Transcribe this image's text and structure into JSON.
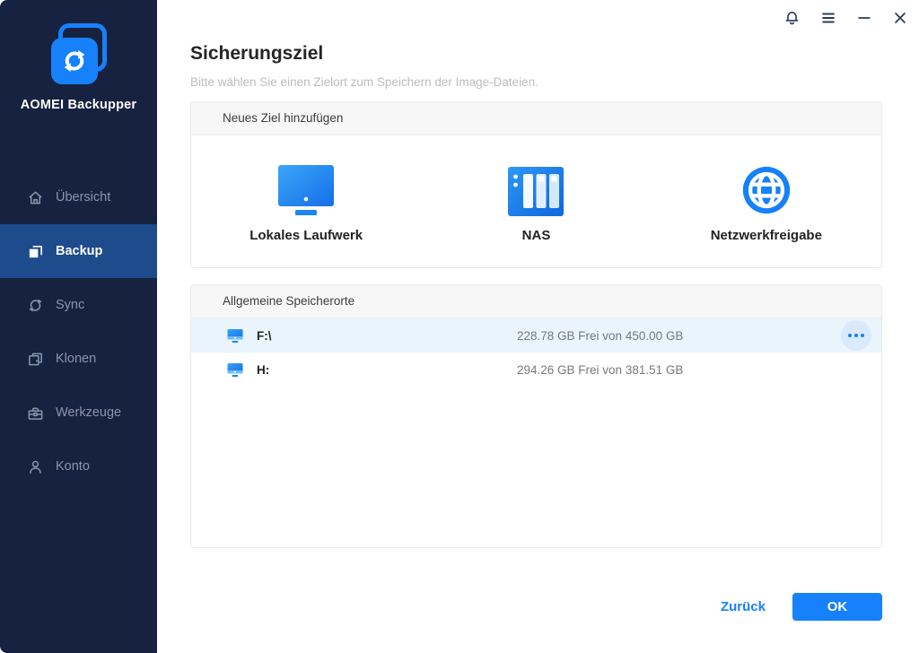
{
  "window": {
    "titlebar_icons": [
      "bell-icon",
      "menu-icon",
      "minimize-icon",
      "close-icon"
    ]
  },
  "sidebar": {
    "brand": "AOMEI Backupper",
    "logo_icon": "sync-arrows-icon",
    "items": [
      {
        "label": "Übersicht",
        "icon": "home-icon",
        "active": false
      },
      {
        "label": "Backup",
        "icon": "backup-icon",
        "active": true
      },
      {
        "label": "Sync",
        "icon": "sync-icon",
        "active": false
      },
      {
        "label": "Klonen",
        "icon": "clone-icon",
        "active": false
      },
      {
        "label": "Werkzeuge",
        "icon": "toolbox-icon",
        "active": false
      },
      {
        "label": "Konto",
        "icon": "person-icon",
        "active": false
      }
    ]
  },
  "main": {
    "title": "Sicherungsziel",
    "subtitle": "Bitte wählen Sie einen Zielort zum Speichern der Image-Dateien.",
    "new_target_panel": {
      "header": "Neues Ziel hinzufügen",
      "options": [
        {
          "label": "Lokales Laufwerk",
          "icon": "local-drive-icon"
        },
        {
          "label": "NAS",
          "icon": "nas-icon"
        },
        {
          "label": "Netzwerkfreigabe",
          "icon": "globe-icon"
        }
      ]
    },
    "locations_panel": {
      "header": "Allgemeine Speicherorte",
      "rows": [
        {
          "drive": "F:\\",
          "free": "228.78 GB Frei von 450.00 GB",
          "selected": true,
          "menu_icon": "ellipsis-icon"
        },
        {
          "drive": "H:",
          "free": "294.26 GB Frei von 381.51 GB",
          "selected": false
        }
      ]
    },
    "footer": {
      "back_label": "Zurück",
      "ok_label": "OK"
    }
  },
  "colors": {
    "accent": "#1681FB",
    "sidebar_bg": "#16223F",
    "sidebar_active_bg": "#1D4B8C",
    "sidebar_inactive_text": "#8997AD",
    "selected_row_bg": "#E9F4FD",
    "panel_header_bg": "#F7F7F8",
    "subtitle_text": "#BCBCBC"
  }
}
